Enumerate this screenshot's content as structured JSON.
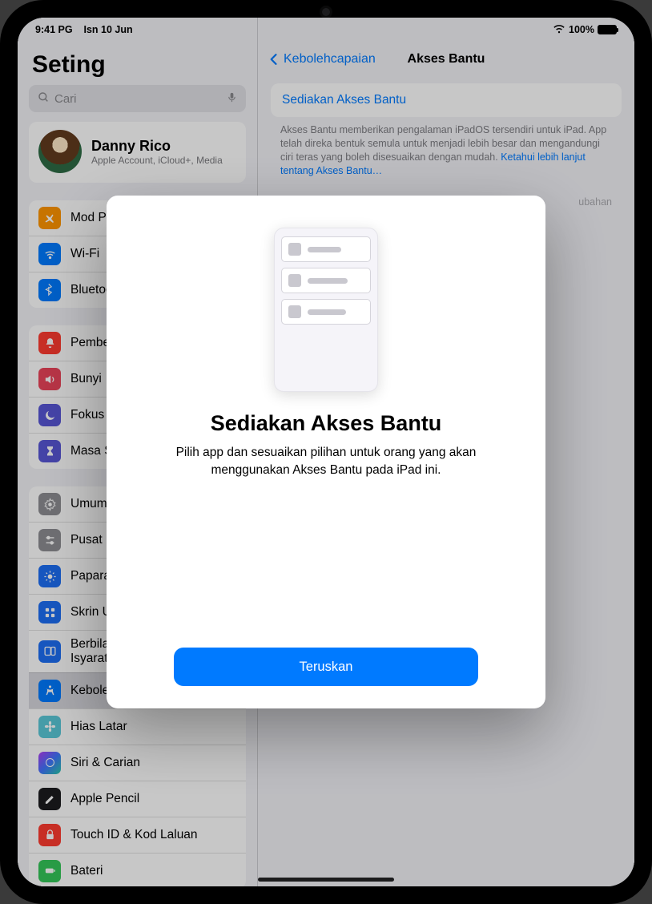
{
  "status": {
    "time": "9:41 PG",
    "date": "Isn 10 Jun",
    "battery": "100%"
  },
  "sidebar": {
    "title": "Seting",
    "search_placeholder": "Cari",
    "profile": {
      "name": "Danny Rico",
      "subtitle": "Apple Account, iCloud+, Media"
    },
    "g1": [
      {
        "label": "Mod Pesawat"
      },
      {
        "label": "Wi-Fi"
      },
      {
        "label": "Bluetooth"
      }
    ],
    "g2": [
      {
        "label": "Pemberitahuan"
      },
      {
        "label": "Bunyi"
      },
      {
        "label": "Fokus"
      },
      {
        "label": "Masa Skrin"
      }
    ],
    "g3": [
      {
        "label": "Umum"
      },
      {
        "label": "Pusat Kawalan"
      },
      {
        "label": "Paparan & Kecerahan"
      },
      {
        "label": "Skrin Utama & Pustaka App"
      },
      {
        "label": "Berbilang Tugas & Gerak Isyarat"
      },
      {
        "label": "Kebolehcapaian"
      },
      {
        "label": "Hias Latar"
      },
      {
        "label": "Siri & Carian"
      },
      {
        "label": "Apple Pencil"
      },
      {
        "label": "Touch ID & Kod Laluan"
      },
      {
        "label": "Bateri"
      }
    ]
  },
  "detail": {
    "back": "Kebolehcapaian",
    "title": "Akses Bantu",
    "card": "Sediakan Akses Bantu",
    "desc": "Akses Bantu memberikan pengalaman iPadOS tersendiri untuk iPad. App telah direka bentuk semula untuk menjadi lebih besar dan mengandungi ciri teras yang boleh disesuaikan dengan mudah.",
    "desc_link": "Ketahui lebih lanjut tentang Akses Bantu…",
    "desc_tail": "ubahan"
  },
  "modal": {
    "heading": "Sediakan Akses Bantu",
    "body": "Pilih app dan sesuaikan pilihan untuk orang yang akan menggunakan Akses Bantu pada iPad ini.",
    "cta": "Teruskan"
  }
}
